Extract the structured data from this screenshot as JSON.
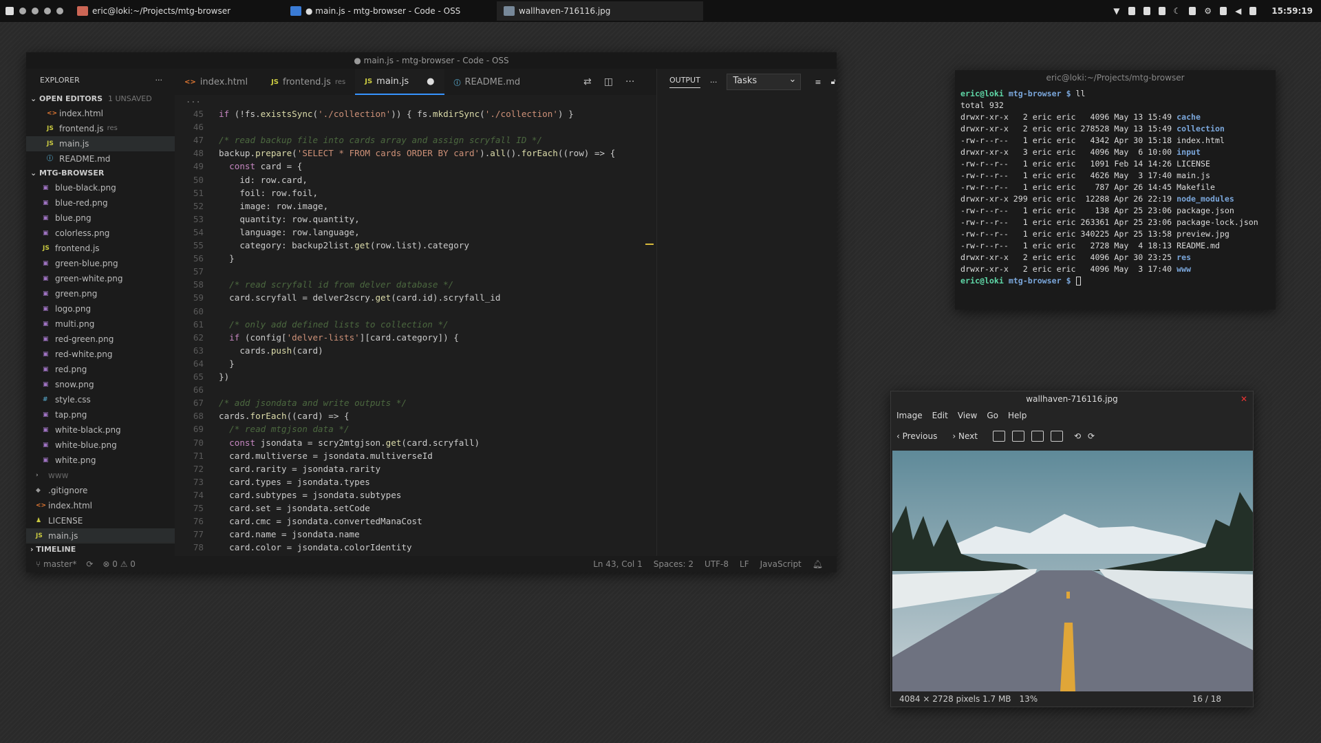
{
  "taskbar": {
    "tasks": [
      {
        "label": "eric@loki:~/Projects/mtg-browser"
      },
      {
        "label": "● main.js - mtg-browser - Code - OSS"
      },
      {
        "label": "wallhaven-716116.jpg"
      }
    ],
    "clock": "15:59:19"
  },
  "vscode": {
    "title": "● main.js - mtg-browser - Code - OSS",
    "explorer_label": "EXPLORER",
    "open_editors": {
      "label": "OPEN EDITORS",
      "badge": "1 UNSAVED",
      "items": [
        {
          "icon": "<>",
          "name": "index.html",
          "extra": ""
        },
        {
          "icon": "JS",
          "name": "frontend.js",
          "extra": "res"
        },
        {
          "icon": "JS",
          "name": "main.js",
          "extra": ""
        },
        {
          "icon": "ⓘ",
          "name": "README.md",
          "extra": ""
        }
      ]
    },
    "project": {
      "label": "MTG-BROWSER",
      "files": [
        "blue-black.png",
        "blue-red.png",
        "blue.png",
        "colorless.png",
        "frontend.js",
        "green-blue.png",
        "green-white.png",
        "green.png",
        "logo.png",
        "multi.png",
        "red-green.png",
        "red-white.png",
        "red.png",
        "snow.png",
        "style.css",
        "tap.png",
        "white-black.png",
        "white-blue.png",
        "white.png"
      ],
      "root": [
        "www",
        ".gitignore",
        "index.html",
        "LICENSE",
        "main.js"
      ]
    },
    "timeline": "TIMELINE",
    "tabs": [
      {
        "icon": "<>",
        "label": "index.html",
        "extra": ""
      },
      {
        "icon": "JS",
        "label": "frontend.js",
        "extra": "res"
      },
      {
        "icon": "JS",
        "label": "main.js",
        "extra": "●"
      },
      {
        "icon": "ⓘ",
        "label": "README.md",
        "extra": ""
      }
    ],
    "panel": {
      "output": "OUTPUT",
      "dots": "···",
      "select": "Tasks"
    },
    "status": {
      "branch": "master*",
      "errors": "⊗ 0 ⚠ 0",
      "pos": "Ln 43, Col 1",
      "spaces": "Spaces: 2",
      "enc": "UTF-8",
      "eol": "LF",
      "lang": "JavaScript"
    },
    "breadcrumb": "...",
    "line_numbers": [
      "45",
      "46",
      "47",
      "48",
      "49",
      "50",
      "51",
      "52",
      "53",
      "54",
      "55",
      "56",
      "57",
      "58",
      "59",
      "60",
      "61",
      "62",
      "63",
      "64",
      "65",
      "66",
      "67",
      "68",
      "69",
      "70",
      "71",
      "72",
      "73",
      "74",
      "75",
      "76",
      "77",
      "78"
    ],
    "code_text": [
      "if (!fs.existsSync('./collection')) { fs.mkdirSync('./collection') }",
      "",
      "/* read backup file into cards array and assign scryfall ID */",
      "backup.prepare('SELECT * FROM cards ORDER BY card').all().forEach((row) => {",
      "  const card = {",
      "    id: row.card,",
      "    foil: row.foil,",
      "    image: row.image,",
      "    quantity: row.quantity,",
      "    language: row.language,",
      "    category: backup2list.get(row.list).category",
      "  }",
      "",
      "  /* read scryfall id from delver database */",
      "  card.scryfall = delver2scry.get(card.id).scryfall_id",
      "",
      "  /* only add defined lists to collection */",
      "  if (config['delver-lists'][card.category]) {",
      "    cards.push(card)",
      "  }",
      "})",
      "",
      "/* add jsondata and write outputs */",
      "cards.forEach((card) => {",
      "  /* read mtgjson data */",
      "  const jsondata = scry2mtgjson.get(card.scryfall)",
      "  card.multiverse = jsondata.multiverseId",
      "  card.rarity = jsondata.rarity",
      "  card.types = jsondata.types",
      "  card.subtypes = jsondata.subtypes",
      "  card.set = jsondata.setCode",
      "  card.cmc = jsondata.convertedManaCost",
      "  card.name = jsondata.name",
      "  card.color = jsondata.colorIdentity"
    ]
  },
  "terminal": {
    "title": "eric@loki:~/Projects/mtg-browser",
    "prompt": "eric@loki mtg-browser $ ",
    "command": "ll",
    "total": "total 932",
    "rows": [
      {
        "meta": "drwxr-xr-x   2 eric eric   4096 May 13 15:49 ",
        "name": "cache",
        "dir": true
      },
      {
        "meta": "drwxr-xr-x   2 eric eric 278528 May 13 15:49 ",
        "name": "collection",
        "dir": true
      },
      {
        "meta": "-rw-r--r--   1 eric eric   4342 Apr 30 15:18 ",
        "name": "index.html",
        "dir": false
      },
      {
        "meta": "drwxr-xr-x   3 eric eric   4096 May  6 10:00 ",
        "name": "input",
        "dir": true
      },
      {
        "meta": "-rw-r--r--   1 eric eric   1091 Feb 14 14:26 ",
        "name": "LICENSE",
        "dir": false
      },
      {
        "meta": "-rw-r--r--   1 eric eric   4626 May  3 17:40 ",
        "name": "main.js",
        "dir": false
      },
      {
        "meta": "-rw-r--r--   1 eric eric    787 Apr 26 14:45 ",
        "name": "Makefile",
        "dir": false
      },
      {
        "meta": "drwxr-xr-x 299 eric eric  12288 Apr 26 22:19 ",
        "name": "node_modules",
        "dir": true
      },
      {
        "meta": "-rw-r--r--   1 eric eric    138 Apr 25 23:06 ",
        "name": "package.json",
        "dir": false
      },
      {
        "meta": "-rw-r--r--   1 eric eric 263361 Apr 25 23:06 ",
        "name": "package-lock.json",
        "dir": false
      },
      {
        "meta": "-rw-r--r--   1 eric eric 340225 Apr 25 13:58 ",
        "name": "preview.jpg",
        "dir": false
      },
      {
        "meta": "-rw-r--r--   1 eric eric   2728 May  4 18:13 ",
        "name": "README.md",
        "dir": false
      },
      {
        "meta": "drwxr-xr-x   2 eric eric   4096 Apr 30 23:25 ",
        "name": "res",
        "dir": true
      },
      {
        "meta": "drwxr-xr-x   2 eric eric   4096 May  3 17:40 ",
        "name": "www",
        "dir": true
      }
    ]
  },
  "viewer": {
    "title": "wallhaven-716116.jpg",
    "menu": [
      "Image",
      "Edit",
      "View",
      "Go",
      "Help"
    ],
    "prev": "Previous",
    "next": "Next",
    "info": "4084 × 2728 pixels  1.7 MB",
    "zoom": "13%",
    "index": "16 / 18"
  }
}
